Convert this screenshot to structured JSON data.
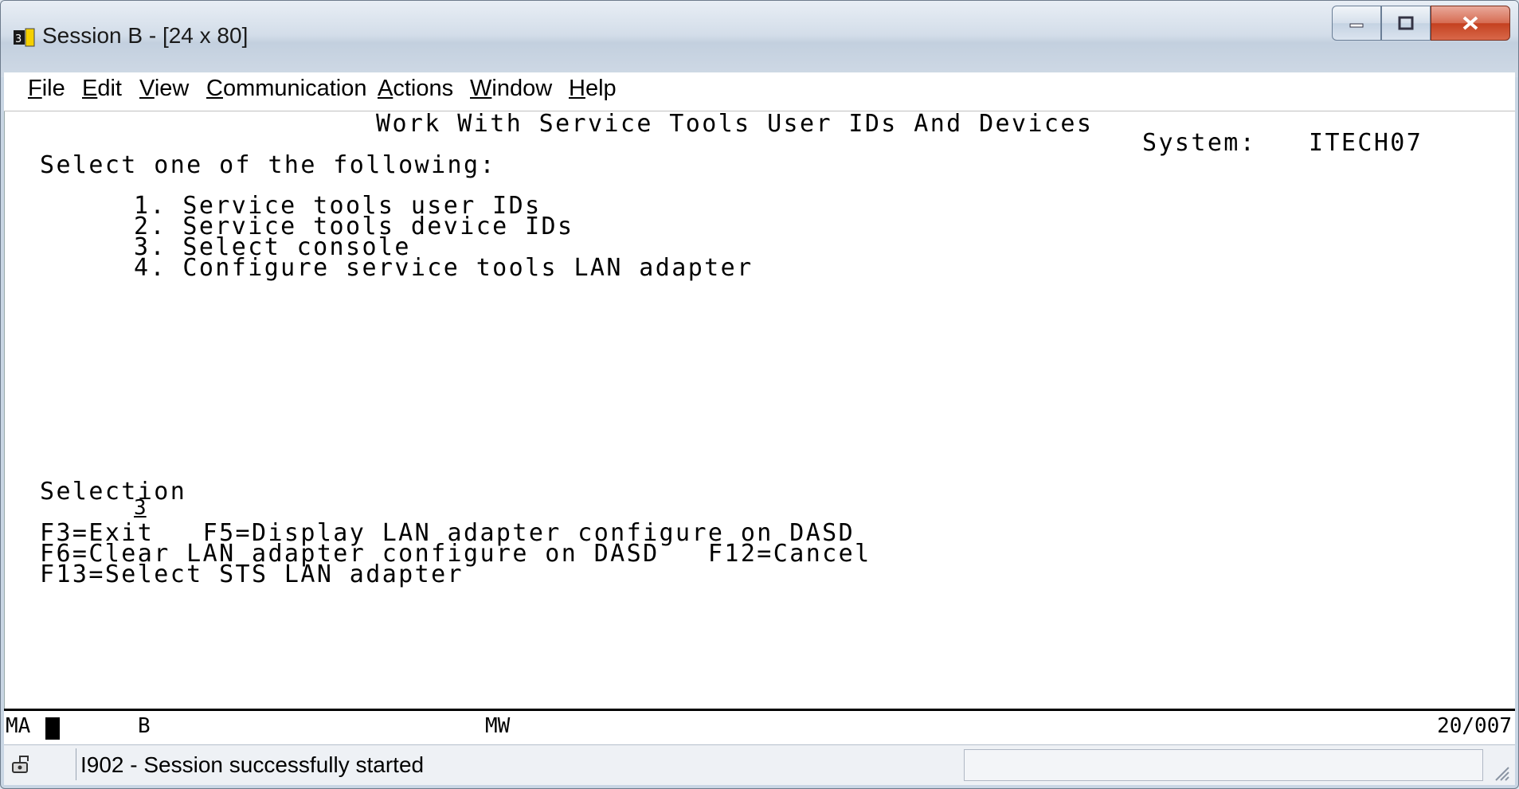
{
  "window": {
    "title": "Session B - [24 x 80]"
  },
  "menu": [
    {
      "key": "F",
      "rest": "ile"
    },
    {
      "key": "E",
      "rest": "dit"
    },
    {
      "key": "V",
      "rest": "iew"
    },
    {
      "key": "C",
      "rest": "ommunication"
    },
    {
      "key": "A",
      "rest": "ctions"
    },
    {
      "key": "W",
      "rest": "indow"
    },
    {
      "key": "H",
      "rest": "elp"
    }
  ],
  "screen": {
    "heading": "Work With Service Tools User IDs And Devices",
    "system_label": "System:",
    "system_value": "ITECH07",
    "prompt": "Select one of the following:",
    "options": [
      "1. Service tools user IDs",
      "2. Service tools device IDs",
      "3. Select console",
      "4. Configure service tools LAN adapter"
    ],
    "selection_label": "Selection",
    "selection_value": "3",
    "fkeys_line1": "F3=Exit   F5=Display LAN adapter configure on DASD",
    "fkeys_line2": "F6=Clear LAN adapter configure on DASD   F12=Cancel",
    "fkeys_line3": "F13=Select STS LAN adapter"
  },
  "oia": {
    "left": "MA",
    "session": "B",
    "mode": "MW",
    "cursor_pos": "20/007"
  },
  "status": {
    "message": "I902 - Session successfully started"
  }
}
